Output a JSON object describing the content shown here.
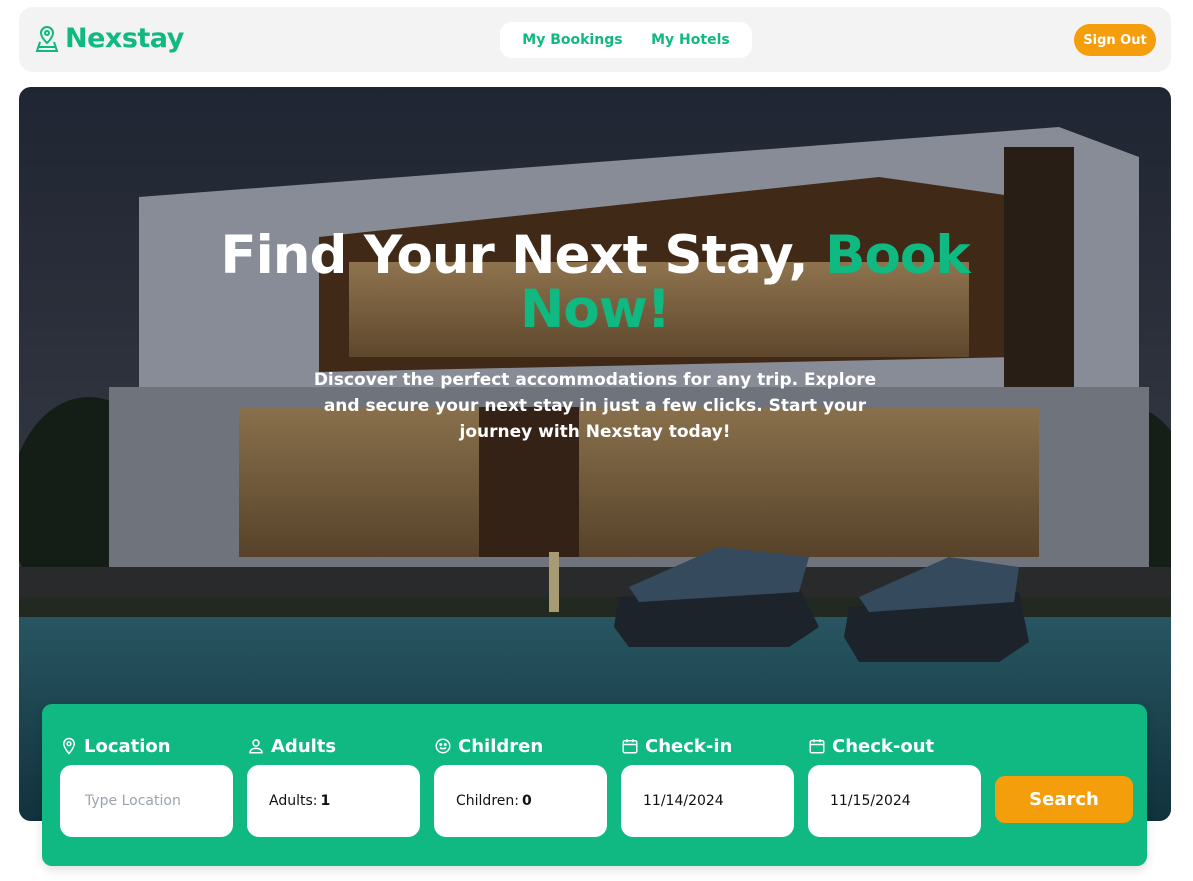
{
  "brand": {
    "name": "Nexstay",
    "icon": "map-pin-icon"
  },
  "nav": {
    "links": [
      {
        "label": "My Bookings"
      },
      {
        "label": "My Hotels"
      }
    ]
  },
  "auth": {
    "signout_label": "Sign Out"
  },
  "hero": {
    "title_main": "Find Your Next Stay, ",
    "title_accent": "Book Now!",
    "subtitle": "Discover the perfect accommodations for any trip. Explore and secure your next stay in just a few clicks. Start your journey with Nexstay today!"
  },
  "search": {
    "location": {
      "label": "Location",
      "icon": "location-pin-icon",
      "placeholder": "Type Location"
    },
    "adults": {
      "label": "Adults",
      "icon": "user-icon",
      "prefix": "Adults:",
      "value": "1"
    },
    "children": {
      "label": "Children",
      "icon": "smiley-icon",
      "prefix": "Children:",
      "value": "0"
    },
    "checkin": {
      "label": "Check-in",
      "icon": "calendar-icon",
      "value": "11/14/2024"
    },
    "checkout": {
      "label": "Check-out",
      "icon": "calendar-icon",
      "value": "11/15/2024"
    },
    "button_label": "Search"
  },
  "colors": {
    "primary": "#10b981",
    "accent": "#f59e0b",
    "navbar_bg": "#f3f3f3"
  }
}
